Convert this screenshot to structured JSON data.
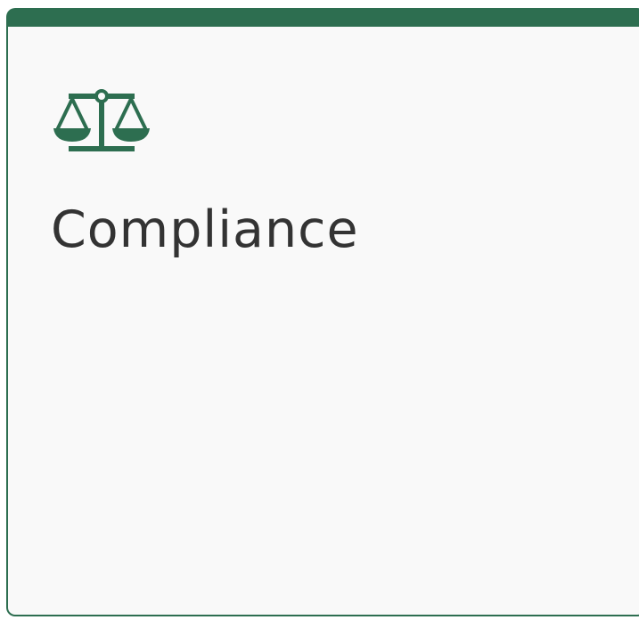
{
  "card": {
    "title": "Compliance",
    "icon": "scales-icon",
    "accent_color": "#2d6e50",
    "text_color": "#333333",
    "background_color": "#f9f9f9"
  }
}
